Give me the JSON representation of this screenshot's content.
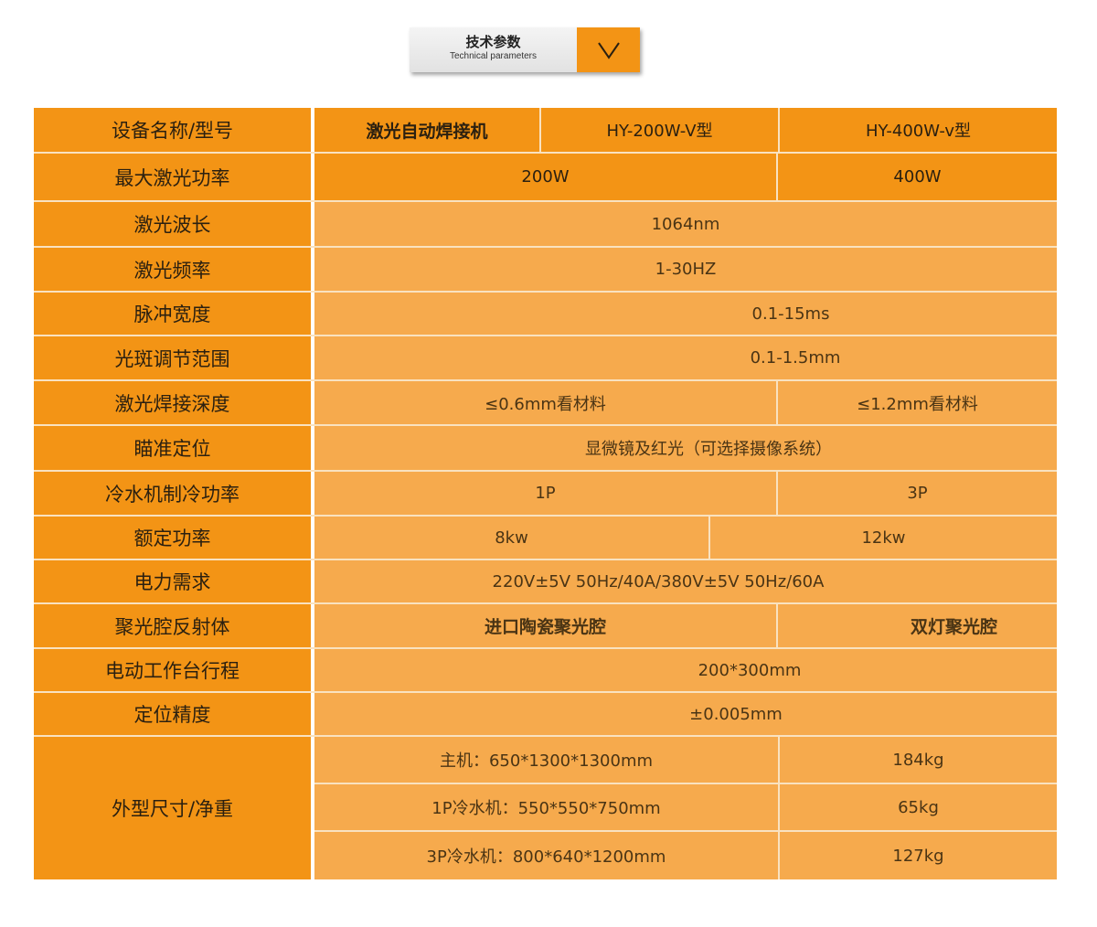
{
  "header": {
    "title": "技术参数",
    "subtitle": "Technical parameters",
    "icon": "chevron-down-icon",
    "accent": "#f39415"
  },
  "rows": [
    {
      "label": "设备名称/型号",
      "values": [
        "激光自动焊接机",
        "HY-200W-V型",
        "HY-400W-v型"
      ]
    },
    {
      "label": "最大激光功率",
      "values": [
        "200W",
        "400W"
      ]
    },
    {
      "label": "激光波长",
      "values": [
        "1064nm"
      ]
    },
    {
      "label": "激光频率",
      "values": [
        "1-30HZ"
      ]
    },
    {
      "label": "脉冲宽度",
      "values": [
        "0.1-15ms"
      ]
    },
    {
      "label": "光斑调节范围",
      "values": [
        "0.1-1.5mm"
      ]
    },
    {
      "label": "激光焊接深度",
      "values": [
        "≤0.6mm看材料",
        "≤1.2mm看材料"
      ]
    },
    {
      "label": "瞄准定位",
      "values": [
        "显微镜及红光（可选择摄像系统）"
      ]
    },
    {
      "label": "冷水机制冷功率",
      "values": [
        "1P",
        "3P"
      ]
    },
    {
      "label": "额定功率",
      "values": [
        "8kw",
        "12kw"
      ]
    },
    {
      "label": "电力需求",
      "values": [
        "220V±5V 50Hz/40A/380V±5V 50Hz/60A"
      ]
    },
    {
      "label": "聚光腔反射体",
      "values": [
        "进口陶瓷聚光腔",
        "双灯聚光腔"
      ]
    },
    {
      "label": "电动工作台行程",
      "values": [
        "200*300mm"
      ]
    },
    {
      "label": "定位精度",
      "values": [
        "±0.005mm"
      ]
    }
  ],
  "dimensions": {
    "label": "外型尺寸/净重",
    "items": [
      {
        "size": "主机：650*1300*1300mm",
        "weight": "184kg"
      },
      {
        "size": "1P冷水机：550*550*750mm",
        "weight": "65kg"
      },
      {
        "size": "3P冷水机：800*640*1200mm",
        "weight": "127kg"
      }
    ]
  }
}
